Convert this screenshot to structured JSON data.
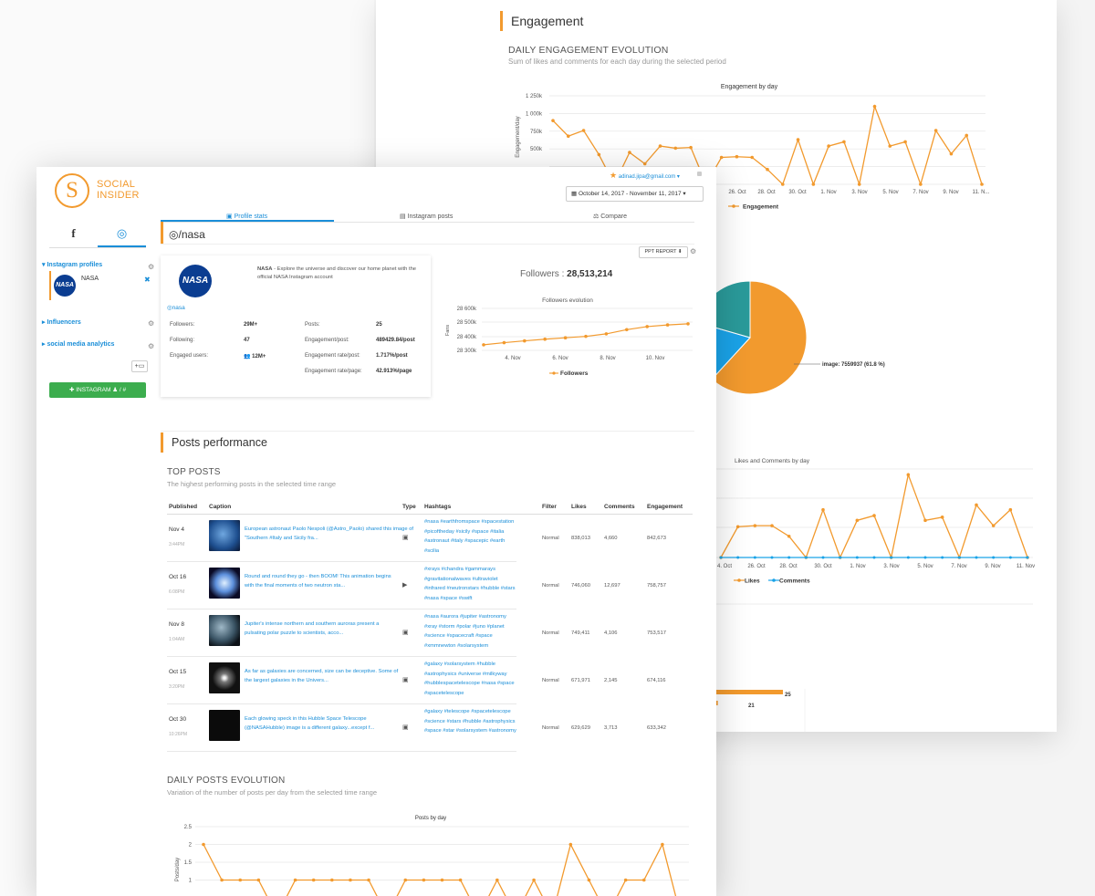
{
  "back": {
    "section_title": "Engagement",
    "daily_title": "DAILY ENGAGEMENT EVOLUTION",
    "daily_sub": "Sum of likes and comments for each day during the selected period",
    "engagement_chart_title": "Engagement by day",
    "engagement_ylabel": "Engagement/day",
    "engagement_legend": "Engagement",
    "pie_label": "image: 7559937 (61.8 %)",
    "likes_chart_title": "Likes and Comments by day",
    "likes_legend": "Likes",
    "comments_legend": "Comments",
    "bar_value_1": "25",
    "bar_value_2": "21"
  },
  "front": {
    "logo_line1": "SOCIAL",
    "logo_line2": "INSIDER",
    "account_email": "adinad.jipa@gmail.com",
    "date_range": "October 14, 2017 - November 11, 2017",
    "nav": {
      "profile_stats": "Profile stats",
      "instagram_posts": "Instagram posts",
      "compare": "Compare"
    },
    "sidebar": {
      "instagram_profiles": "Instagram profiles",
      "profile_name": "NASA",
      "influencers": "Influencers",
      "social_media_analytics": "social media analytics",
      "add_button": "INSTAGRAM",
      "add_suffix": "/ #"
    },
    "handle": "/nasa",
    "ppt_button": "PPT REPORT",
    "profile": {
      "logo_text": "NASA",
      "name": "NASA",
      "description": "- Explore the universe and discover our home planet with the official NASA Instagram account",
      "handle_link": "nasa",
      "followers_label": "Followers:",
      "followers_value": "29M+",
      "following_label": "Following:",
      "following_value": "47",
      "engaged_label": "Engaged users:",
      "engaged_value": "12M+",
      "posts_label": "Posts:",
      "posts_value": "25",
      "eng_post_label": "Engagement/post:",
      "eng_post_value": "489429.84/post",
      "eng_rate_post_label": "Engagement rate/post:",
      "eng_rate_post_value": "1.717%/post",
      "eng_rate_page_label": "Engagement rate/page:",
      "eng_rate_page_value": "42.913%/page"
    },
    "followers_headline_label": "Followers :",
    "followers_headline_value": "28,513,214",
    "followers_chart_title": "Followers evolution",
    "followers_ylabel": "Fans",
    "followers_legend": "Followers",
    "posts_perf_title": "Posts performance",
    "top_posts_title": "TOP POSTS",
    "top_posts_sub": "The highest performing posts in the selected time range",
    "table_headers": [
      "Published",
      "Caption",
      "Type",
      "Hashtags",
      "Filter",
      "Likes",
      "Comments",
      "Engagement"
    ],
    "posts": [
      {
        "date": "Nov 4",
        "time": "3:44PM",
        "caption": "European astronaut Paolo Nespoli (@Astro_Paolo) shared this image of \"Southern #Italy and Sicily fra...",
        "type_icon": "image-icon",
        "hashtags": "#nasa #earthfromspace #spacestation #picoftheday #sicily #space #italia #astronaut #italy #spacepic #earth #scilia",
        "filter": "Normal",
        "likes": "838,013",
        "comments": "4,660",
        "engagement": "842,673"
      },
      {
        "date": "Oct 16",
        "time": "6:08PM",
        "caption": "Round and round they go - then BOOM! This animation begins with the final moments of two neutron sta...",
        "type_icon": "video-icon",
        "hashtags": "#xrays #chandra #gammarays #gravitationalwaves #ultraviolet #infrared #neutronstars #hubble #stars #nasa #space #swift",
        "filter": "Normal",
        "likes": "746,060",
        "comments": "12,697",
        "engagement": "758,757"
      },
      {
        "date": "Nov 8",
        "time": "1:04AM",
        "caption": "Jupiter's intense northern and southern auroras present a pulsating polar puzzle to scientists, acco...",
        "type_icon": "image-icon",
        "hashtags": "#nasa #aurora #jupiter #astronomy #xray #storm #polar #juno #planet #science #spacecraft #space #xmmnewton #solarsystem",
        "filter": "Normal",
        "likes": "749,411",
        "comments": "4,106",
        "engagement": "753,517"
      },
      {
        "date": "Oct 15",
        "time": "3:20PM",
        "caption": "As far as galaxies are concerned, size can be deceptive. Some of the largest galaxies in the Univers...",
        "type_icon": "image-icon",
        "hashtags": "#galaxy #solarsystem #hubble #astrophysics #universe #milkyway #hubblespacetelescope #nasa #space #spacetelescope",
        "filter": "Normal",
        "likes": "671,971",
        "comments": "2,145",
        "engagement": "674,116"
      },
      {
        "date": "Oct 30",
        "time": "10:26PM",
        "caption": "Each glowing speck in this Hubble Space Telescope (@NASAHubble) image is a different galaxy...except f...",
        "type_icon": "image-icon",
        "hashtags": "#galaxy #telescope #spacetelescope #science #stars #hubble #astrophysics #space #star #solarsystem #astronomy",
        "filter": "Normal",
        "likes": "629,629",
        "comments": "3,713",
        "engagement": "633,342"
      }
    ],
    "daily_posts_title": "DAILY POSTS EVOLUTION",
    "daily_posts_sub": "Variation of the number of posts per day from the selected time range",
    "posts_chart_title": "Posts by day",
    "posts_ylabel": "Posts/day"
  },
  "chart_data": [
    {
      "type": "line",
      "title": "Engagement by day",
      "ylabel": "Engagement/day",
      "ylim": [
        0,
        1250000
      ],
      "y_ticks": [
        "1 250k",
        "1 000k",
        "750k",
        "500k"
      ],
      "x_ticks": [
        "26. Oct",
        "28. Oct",
        "30. Oct",
        "1. Nov",
        "3. Nov",
        "5. Nov",
        "7. Nov",
        "9. Nov",
        "11. N..."
      ],
      "series": [
        {
          "name": "Engagement",
          "values": [
            900000,
            680000,
            760000,
            420000,
            0,
            450000,
            290000,
            540000,
            510000,
            520000,
            0,
            380000,
            390000,
            380000,
            210000,
            0,
            630000,
            0,
            540000,
            600000,
            0,
            1100000,
            540000,
            600000,
            0,
            760000,
            430000,
            690000,
            0
          ]
        }
      ]
    },
    {
      "type": "pie",
      "slices": [
        {
          "label": "image",
          "value": 7559937,
          "percent": 61.8,
          "color": "#f29a2e"
        },
        {
          "value": null,
          "color": "#1aa3e8"
        },
        {
          "value": null,
          "color": "#2a9a9a"
        }
      ]
    },
    {
      "type": "line",
      "title": "Likes and Comments by day",
      "x_ticks": [
        "4. Oct",
        "26. Oct",
        "28. Oct",
        "30. Oct",
        "1. Nov",
        "3. Nov",
        "5. Nov",
        "7. Nov",
        "9. Nov",
        "11. Nov"
      ],
      "series": [
        {
          "name": "Likes",
          "values": [
            0,
            580000,
            600000,
            600000,
            400000,
            0,
            900000,
            0,
            700000,
            790000,
            0,
            1560000,
            700000,
            760000,
            0,
            990000,
            600000,
            900000,
            0
          ]
        },
        {
          "name": "Comments",
          "values": [
            0,
            0,
            0,
            0,
            0,
            0,
            0,
            0,
            0,
            0,
            0,
            0,
            0,
            0,
            0,
            0,
            0,
            0,
            0
          ]
        }
      ]
    },
    {
      "type": "bar",
      "values": [
        25,
        21
      ]
    },
    {
      "type": "line",
      "title": "Followers evolution",
      "ylabel": "Fans",
      "ylim": [
        28300000,
        28600000
      ],
      "y_ticks": [
        "28 600k",
        "28 500k",
        "28 400k",
        "28 300k"
      ],
      "x_ticks": [
        "4. Nov",
        "6. Nov",
        "8. Nov",
        "10. Nov"
      ],
      "series": [
        {
          "name": "Followers",
          "values": [
            28340000,
            28355000,
            28368000,
            28380000,
            28390000,
            28400000,
            28418000,
            28448000,
            28470000,
            28482000,
            28490000
          ]
        }
      ]
    },
    {
      "type": "line",
      "title": "Posts by day",
      "ylabel": "Posts/day",
      "ylim": [
        0,
        2.5
      ],
      "y_ticks": [
        "2.5",
        "2",
        "1.5",
        "1"
      ],
      "series": [
        {
          "values": [
            2,
            1,
            1,
            1,
            0,
            1,
            1,
            1,
            1,
            1,
            0,
            1,
            1,
            1,
            1,
            0,
            1,
            0,
            1,
            0,
            2,
            1,
            0,
            1,
            1,
            2,
            0
          ]
        }
      ]
    }
  ]
}
